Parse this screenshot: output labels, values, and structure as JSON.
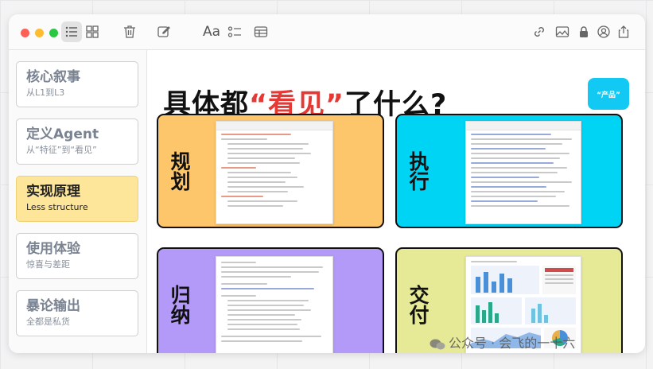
{
  "sidebar": {
    "items": [
      {
        "title": "核心叙事",
        "subtitle": "从L1到L3"
      },
      {
        "title": "定义Agent",
        "subtitle": "从“特征”到“看见”"
      },
      {
        "title": "实现原理",
        "subtitle": "Less structure"
      },
      {
        "title": "使用体验",
        "subtitle": "惊喜与差距"
      },
      {
        "title": "暴论输出",
        "subtitle": "全都是私货"
      }
    ],
    "active_index": 2
  },
  "main": {
    "title_prefix": "具体都",
    "title_highlight": "“看见”",
    "title_suffix": "了什么?",
    "tag_label": "“产品”",
    "quadrants": [
      {
        "label": "规划",
        "color": "#fdc66b"
      },
      {
        "label": "执行",
        "color": "#00d4f5"
      },
      {
        "label": "归纳",
        "color": "#b49af8"
      },
      {
        "label": "交付",
        "color": "#e6ea96"
      }
    ]
  },
  "watermark": "公众号 · 会飞的一十六",
  "colors": {
    "active_nav": "#fde69a",
    "title_highlight": "#e53935",
    "tag": "#12c9f3",
    "light_red": "#fe5f57",
    "light_yellow": "#febc2e",
    "light_green": "#28c840"
  },
  "icons": [
    "list-view-icon",
    "grid-view-icon",
    "trash-icon",
    "compose-icon",
    "text-format-icon",
    "checklist-icon",
    "table-icon",
    "link-icon",
    "media-icon",
    "lock-icon",
    "account-icon",
    "share-icon"
  ]
}
